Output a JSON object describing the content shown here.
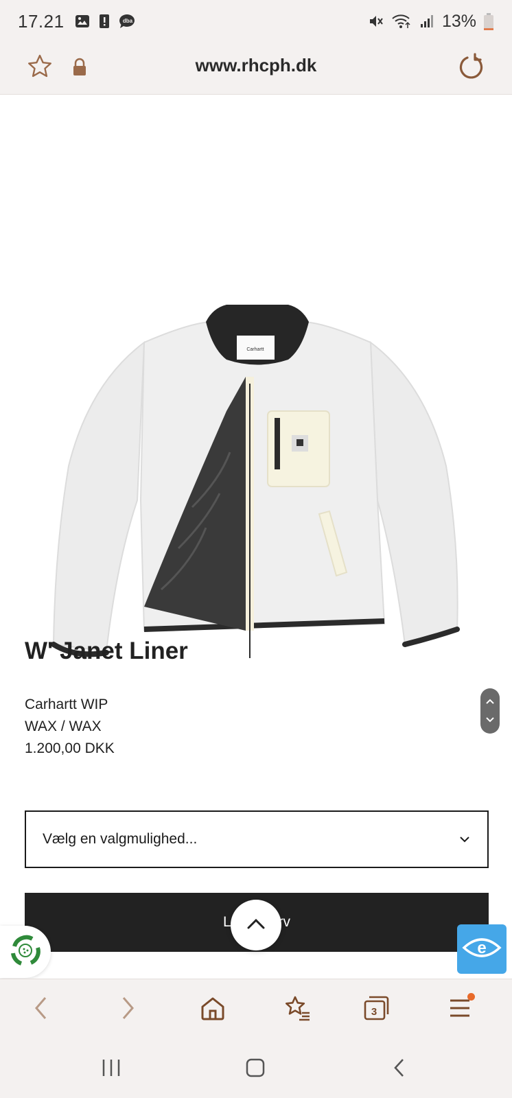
{
  "status_bar": {
    "time": "17.21",
    "notification_icons": [
      "image-icon",
      "alert-icon",
      "dba-icon"
    ],
    "dba_label": "dba",
    "system_icons": [
      "mute-icon",
      "wifi-icon",
      "signal-icon"
    ],
    "battery_percent": "13%",
    "battery_level": 0.13
  },
  "browser": {
    "url": "www.rhcph.dk",
    "tab_count": "3",
    "accent_color": "#8a5a3a"
  },
  "product": {
    "image_alt": "W' Janet Liner fleece jacket",
    "label_text": "Carhartt",
    "title": "W' Janet Liner",
    "brand": "Carhartt WIP",
    "color": "WAX / WAX",
    "price": "1.200,00 DKK",
    "select_placeholder": "Vælg en valgmulighed...",
    "cart_button_label": "Læg i kurv"
  },
  "colors": {
    "chrome_bg": "#f4f1f0",
    "button_dark": "#222222",
    "accessibility_blue": "#45a7e8",
    "eco_green": "#2f8a3a",
    "notification_orange": "#e86a2a"
  }
}
